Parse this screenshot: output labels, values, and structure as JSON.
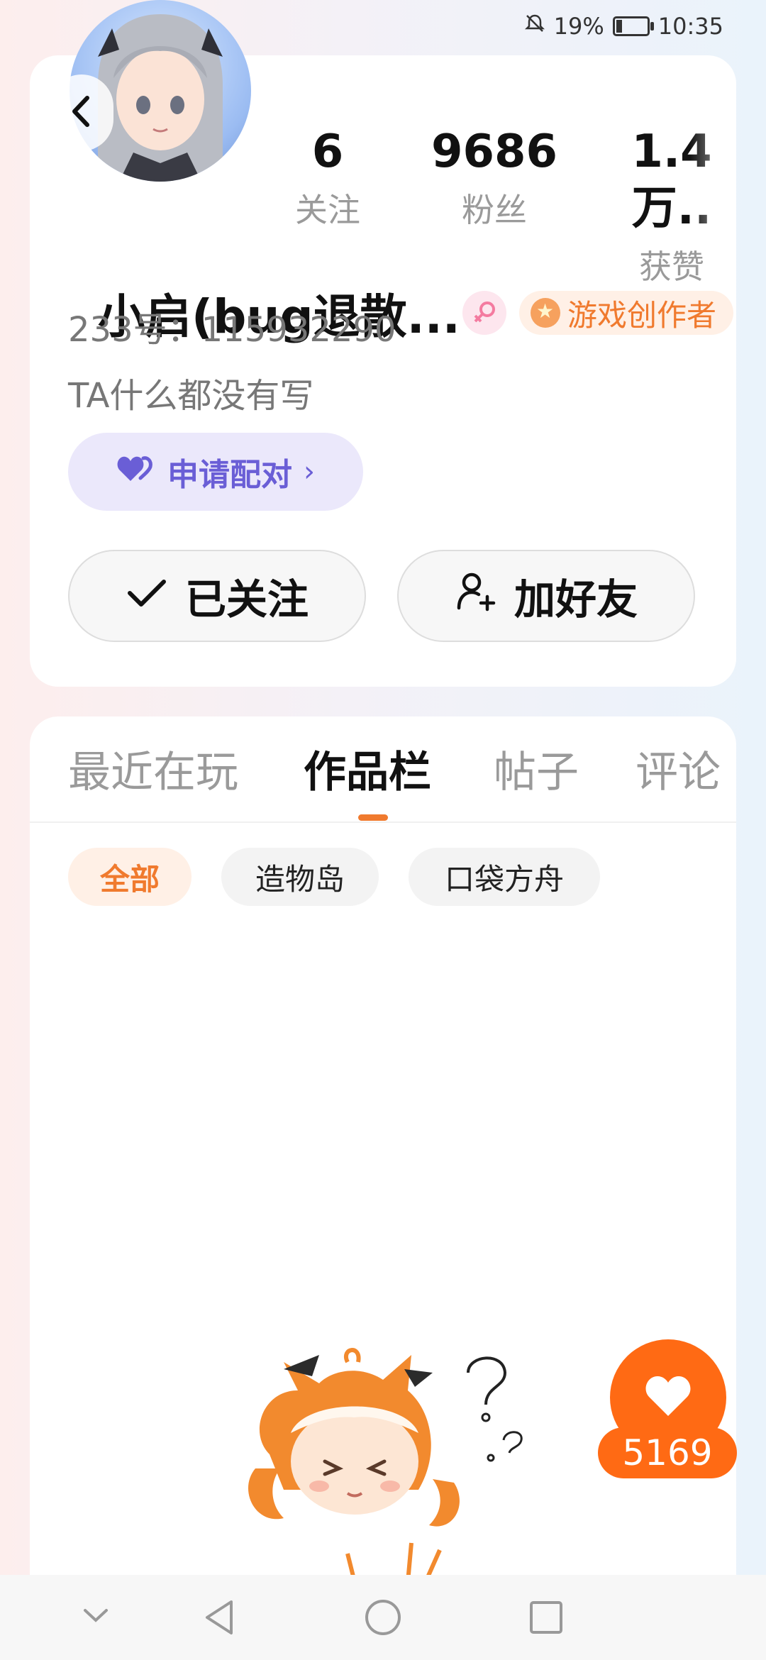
{
  "status_bar": {
    "battery_text": "19%",
    "battery_level": 0.19,
    "time": "10:35"
  },
  "profile": {
    "stats": [
      {
        "value": "6",
        "label": "关注"
      },
      {
        "value": "9686",
        "label": "粉丝"
      },
      {
        "value": "1.4万..",
        "label": "获赞"
      }
    ],
    "name": "小启(bug退散...",
    "creator_badge": "游戏创作者",
    "uid": "233号：115932290",
    "bio": "TA什么都没有写",
    "pair_button": "申请配对",
    "pair_chevron": "›",
    "follow_button": "已关注",
    "add_friend_button": "加好友"
  },
  "tabs": [
    "最近在玩",
    "作品栏",
    "帖子",
    "评论"
  ],
  "active_tab": "作品栏",
  "filters": [
    "全部",
    "造物岛",
    "口袋方舟"
  ],
  "active_filter": "全部",
  "like_count": "5169",
  "colors": {
    "accent_orange": "#f07a2e",
    "like_orange": "#ff6a14",
    "pair_purple": "#6a5ed6",
    "pair_bg": "#ebe8fb"
  },
  "icons": {
    "back": "chevron-left-icon",
    "female": "female-icon",
    "heart": "heart-icon",
    "check": "check-icon",
    "add_user": "add-user-icon",
    "nav": [
      "chevron-down-icon",
      "back-triangle-icon",
      "home-circle-icon",
      "recent-square-icon"
    ]
  }
}
